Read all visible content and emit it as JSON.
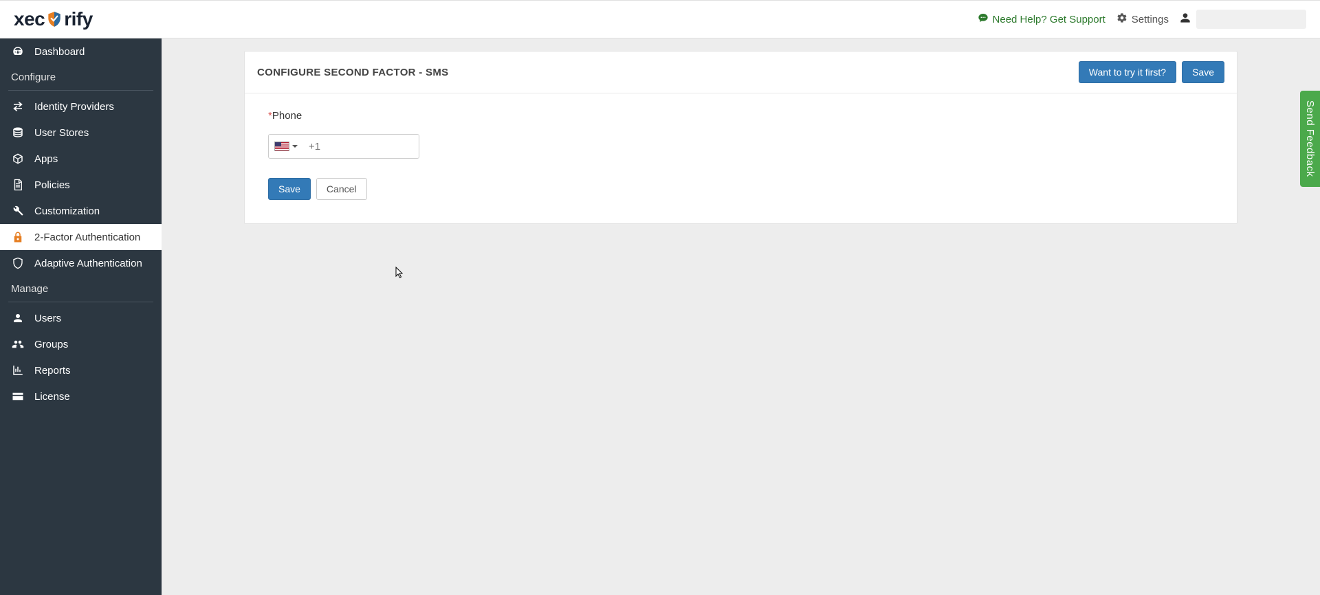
{
  "logo": {
    "part1": "xec",
    "part2": "rify"
  },
  "topbar": {
    "help": "Need Help? Get Support",
    "settings": "Settings"
  },
  "sidebar": {
    "dashboard": "Dashboard",
    "configure_label": "Configure",
    "identity_providers": "Identity Providers",
    "user_stores": "User Stores",
    "apps": "Apps",
    "policies": "Policies",
    "customization": "Customization",
    "two_factor": "2-Factor Authentication",
    "adaptive": "Adaptive Authentication",
    "manage_label": "Manage",
    "users": "Users",
    "groups": "Groups",
    "reports": "Reports",
    "license": "License"
  },
  "panel": {
    "title": "CONFIGURE SECOND FACTOR - SMS",
    "try_first": "Want to try it first?",
    "save_top": "Save",
    "phone_label": "Phone",
    "dial_code": "+1",
    "phone_value": "",
    "save": "Save",
    "cancel": "Cancel"
  },
  "feedback": "Send Feedback"
}
